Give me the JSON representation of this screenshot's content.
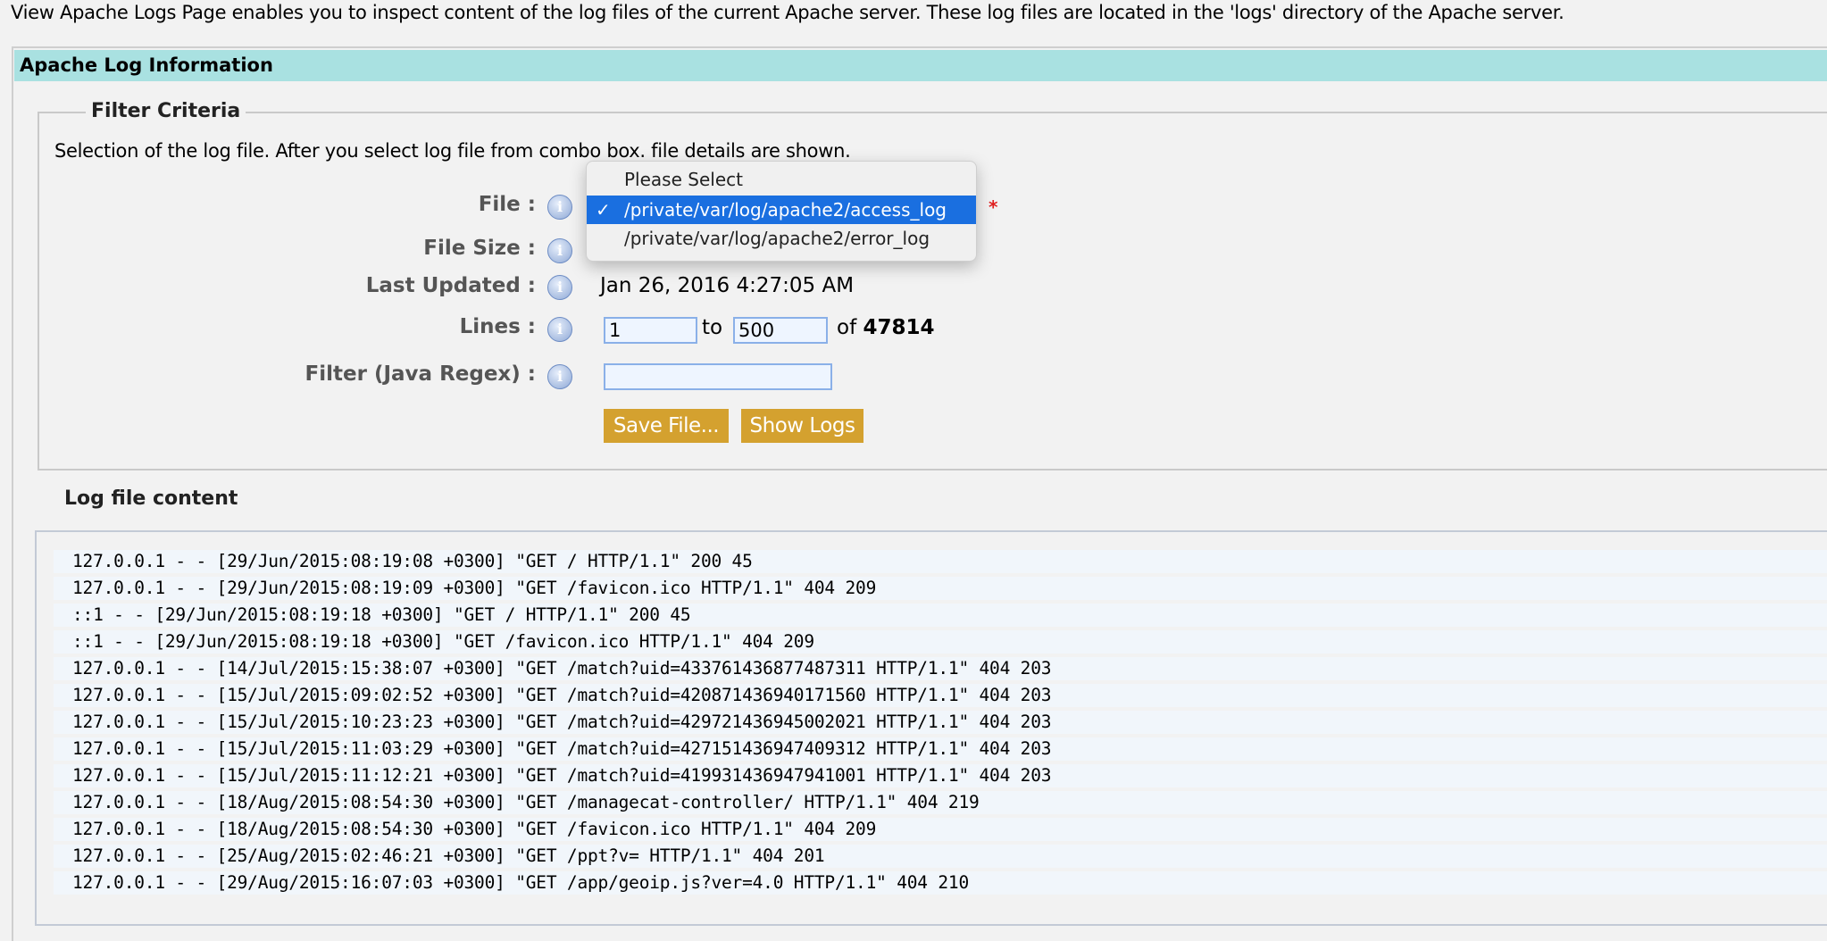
{
  "intro": "View Apache Logs Page enables you to inspect content of the log files of the current Apache server. These log files are located in the 'logs' directory of the Apache server.",
  "panel_title": "Apache Log Information",
  "filter": {
    "legend": "Filter Criteria",
    "description": "Selection of the log file. After you select log file from combo box. file details are shown.",
    "labels": {
      "file": "File :",
      "file_size": "File Size :",
      "last_updated": "Last Updated :",
      "lines": "Lines :",
      "regex": "Filter (Java Regex) :"
    },
    "info_icon": "i",
    "required_mark": "*",
    "last_updated_value": "Jan 26, 2016 4:27:05 AM",
    "lines_from": "1",
    "lines_to_label": "to",
    "lines_to": "500",
    "lines_of_label": "of",
    "lines_total": "47814",
    "regex_value": "",
    "save_button": "Save File...",
    "show_button": "Show Logs"
  },
  "dropdown": {
    "check": "✓",
    "options": [
      {
        "label": "Please Select"
      },
      {
        "label": "/private/var/log/apache2/access_log",
        "selected": true
      },
      {
        "label": "/private/var/log/apache2/error_log"
      }
    ]
  },
  "log": {
    "heading": "Log file content",
    "lines": [
      "127.0.0.1 - - [29/Jun/2015:08:19:08 +0300] \"GET / HTTP/1.1\" 200 45",
      "127.0.0.1 - - [29/Jun/2015:08:19:09 +0300] \"GET /favicon.ico HTTP/1.1\" 404 209",
      "::1 - - [29/Jun/2015:08:19:18 +0300] \"GET / HTTP/1.1\" 200 45",
      "::1 - - [29/Jun/2015:08:19:18 +0300] \"GET /favicon.ico HTTP/1.1\" 404 209",
      "127.0.0.1 - - [14/Jul/2015:15:38:07 +0300] \"GET /match?uid=433761436877487311 HTTP/1.1\" 404 203",
      "127.0.0.1 - - [15/Jul/2015:09:02:52 +0300] \"GET /match?uid=420871436940171560 HTTP/1.1\" 404 203",
      "127.0.0.1 - - [15/Jul/2015:10:23:23 +0300] \"GET /match?uid=429721436945002021 HTTP/1.1\" 404 203",
      "127.0.0.1 - - [15/Jul/2015:11:03:29 +0300] \"GET /match?uid=427151436947409312 HTTP/1.1\" 404 203",
      "127.0.0.1 - - [15/Jul/2015:11:12:21 +0300] \"GET /match?uid=419931436947941001 HTTP/1.1\" 404 203",
      "127.0.0.1 - - [18/Aug/2015:08:54:30 +0300] \"GET /managecat-controller/ HTTP/1.1\" 404 219",
      "127.0.0.1 - - [18/Aug/2015:08:54:30 +0300] \"GET /favicon.ico HTTP/1.1\" 404 209",
      "127.0.0.1 - - [25/Aug/2015:02:46:21 +0300] \"GET /ppt?v= HTTP/1.1\" 404 201",
      "127.0.0.1 - - [29/Aug/2015:16:07:03 +0300] \"GET /app/geoip.js?ver=4.0 HTTP/1.1\" 404 210"
    ]
  },
  "colors": {
    "header": "#a9e1e1",
    "button": "#d4a12f",
    "selected": "#1a6fe0",
    "required": "#e02020"
  }
}
